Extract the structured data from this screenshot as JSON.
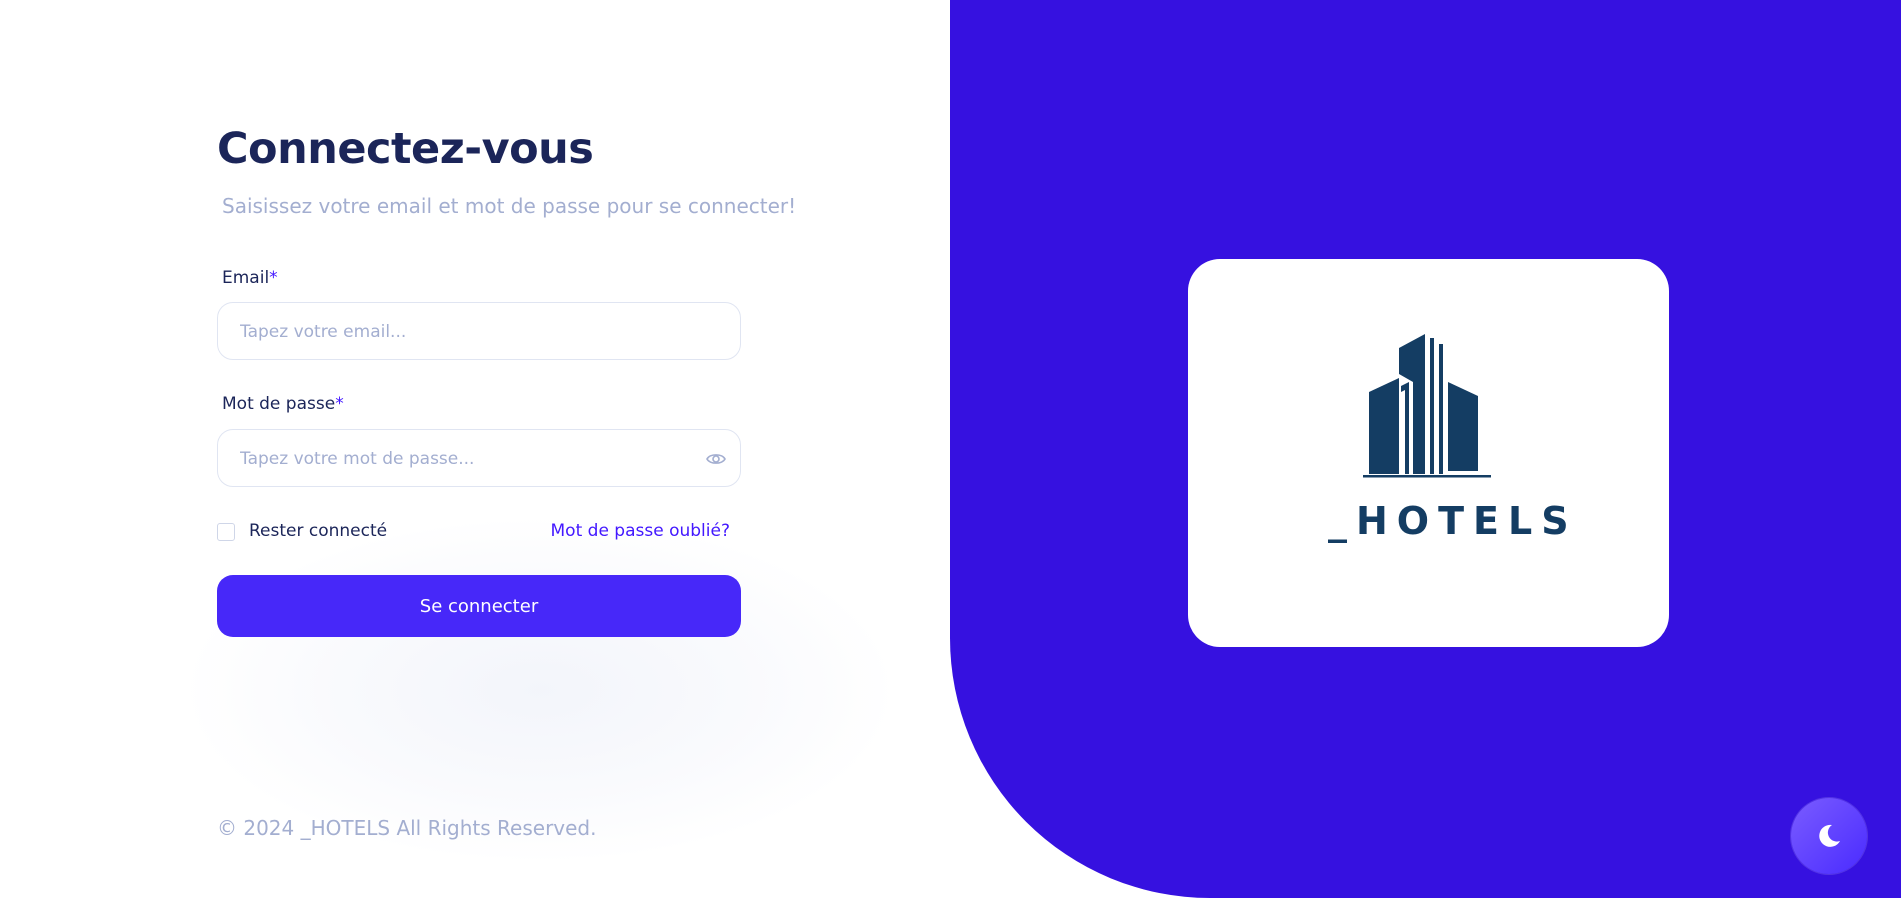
{
  "login": {
    "title": "Connectez-vous",
    "subtitle": "Saisissez votre email et mot de passe pour se connecter!",
    "email_label": "Email",
    "email_placeholder": "Tapez votre email...",
    "password_label": "Mot de passe",
    "password_placeholder": "Tapez votre mot de passe...",
    "required_mark": "*",
    "remember_label": "Rester connecté",
    "forgot_label": "Mot de passe oublié?",
    "submit_label": "Se connecter"
  },
  "footer": {
    "copyright": "© 2024 _HOTELS All Rights Reserved."
  },
  "brand": {
    "wordmark": "_HOTELS",
    "logo_icon": "building-icon"
  },
  "theme_toggle": {
    "icon": "moon-icon"
  },
  "colors": {
    "accent": "#4318ff",
    "panel": "#3611e0",
    "button": "#4728f9",
    "title": "#1b2559",
    "muted": "#a3aed0",
    "logo": "#143d63"
  }
}
